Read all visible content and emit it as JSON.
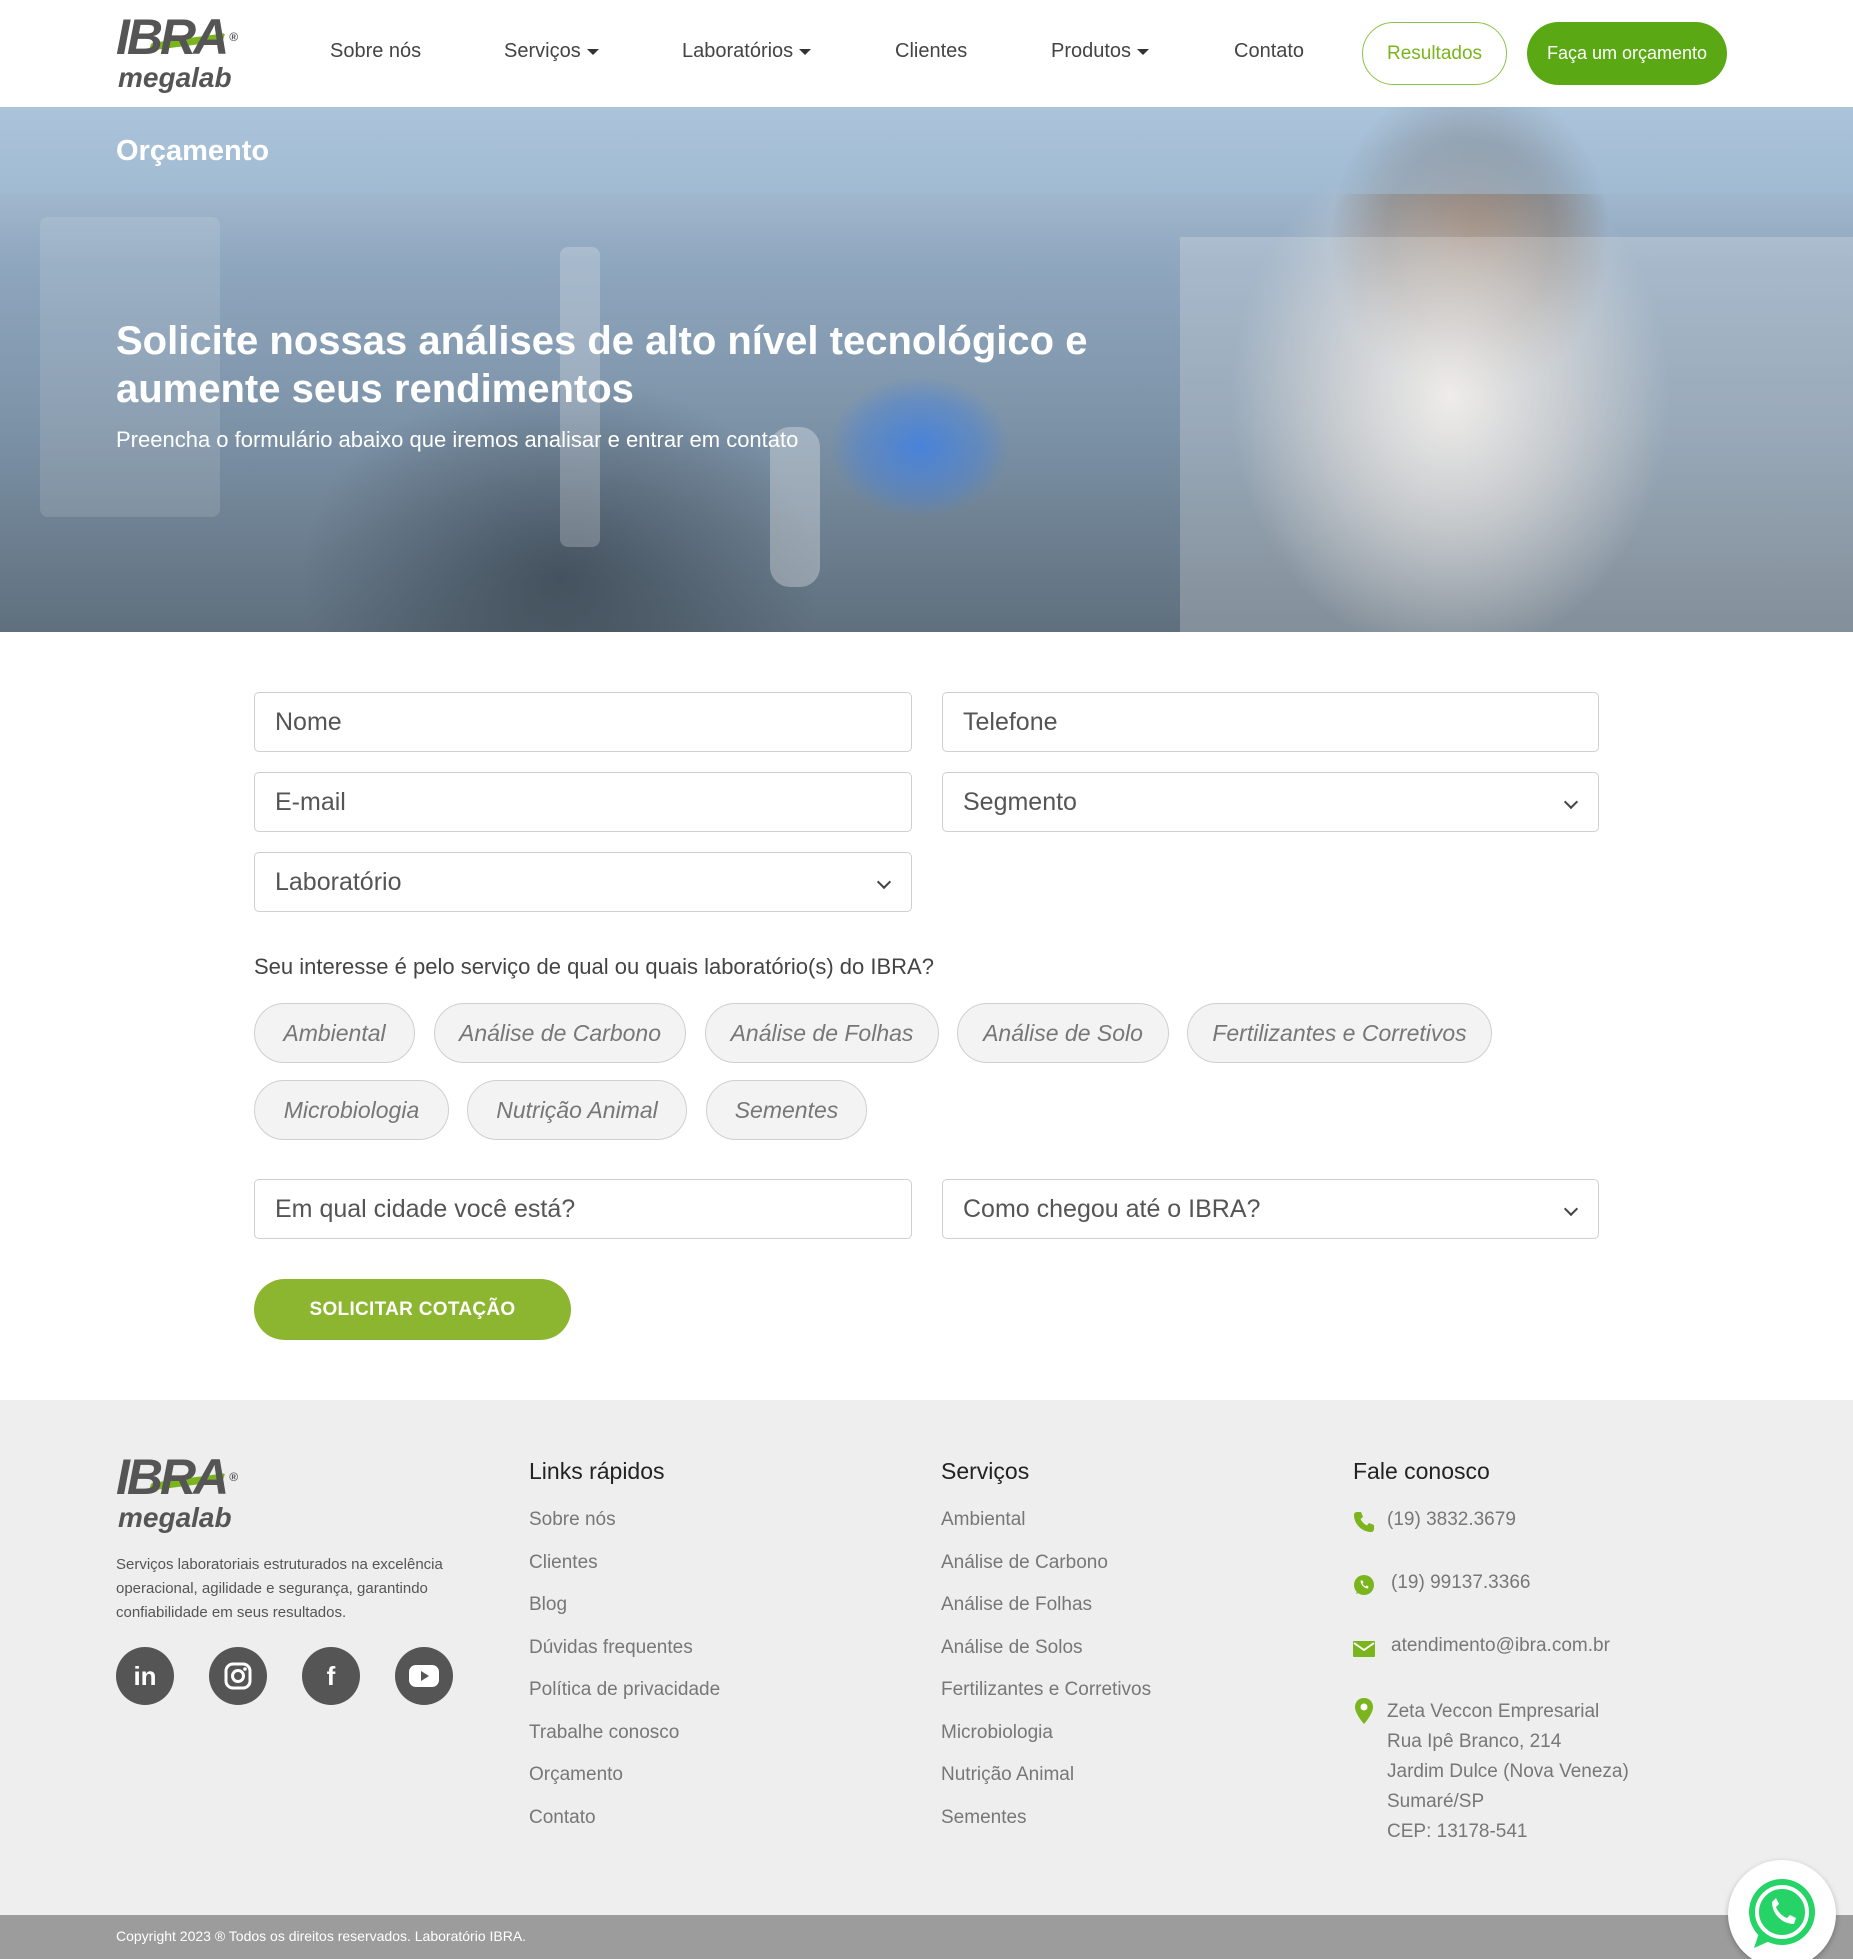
{
  "header": {
    "logo_brand": "IBRA",
    "logo_sub": "megalab",
    "nav": [
      "Sobre nós",
      "Serviços",
      "Laboratórios",
      "Clientes",
      "Produtos",
      "Contato"
    ],
    "results_label": "Resultados",
    "quote_label": "Faça um orçamento"
  },
  "hero": {
    "breadcrumb": "Orçamento",
    "title": "Solicite nossas análises de alto nível tecnológico e aumente seus rendimentos",
    "subtitle": "Preencha o formulário abaixo que iremos analisar e entrar em contato"
  },
  "form": {
    "name_placeholder": "Nome",
    "phone_placeholder": "Telefone",
    "email_placeholder": "E-mail",
    "segment_label": "Segmento",
    "lab_label": "Laboratório",
    "question": "Seu interesse é pelo serviço de qual ou quais laboratório(s) do IBRA?",
    "chips": [
      "Ambiental",
      "Análise de Carbono",
      "Análise de Folhas",
      "Análise de Solo",
      "Fertilizantes e Corretivos",
      "Microbiologia",
      "Nutrição Animal",
      "Sementes"
    ],
    "city_placeholder": "Em qual cidade você está?",
    "source_label": "Como chegou até o IBRA?",
    "submit_label": "SOLICITAR COTAÇÃO"
  },
  "footer": {
    "description": "Serviços laboratoriais estruturados na excelência operacional, agilidade e segurança, garantindo confiabilidade em seus resultados.",
    "quick_links_title": "Links rápidos",
    "quick_links": [
      "Sobre nós",
      "Clientes",
      "Blog",
      "Dúvidas frequentes",
      "Política de privacidade",
      "Trabalhe conosco",
      "Orçamento",
      "Contato"
    ],
    "services_title": "Serviços",
    "services": [
      "Ambiental",
      "Análise de Carbono",
      "Análise de Folhas",
      "Análise de Solos",
      "Fertilizantes e Corretivos",
      "Microbiologia",
      "Nutrição Animal",
      "Sementes"
    ],
    "contact_title": "Fale conosco",
    "phone": "(19) 3832.3679",
    "whatsapp": "(19) 99137.3366",
    "email": "atendimento@ibra.com.br",
    "address": [
      "Zeta Veccon Empresarial",
      "Rua Ipê Branco, 214",
      "Jardim Dulce (Nova Veneza)",
      "Sumaré/SP",
      "CEP: 13178-541"
    ],
    "copyright": "Copyright 2023 ® Todos os direitos reservados. Laboratório IBRA."
  },
  "colors": {
    "accent_green": "#5aa914",
    "submit_green": "#8cb530",
    "footer_bg": "#eeeeee"
  }
}
